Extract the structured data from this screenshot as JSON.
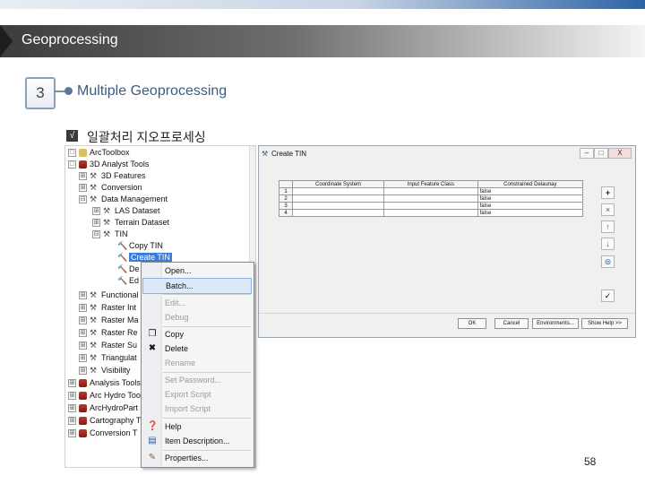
{
  "banner": {
    "title": "Geoprocessing"
  },
  "section": {
    "number": "3",
    "heading": "Multiple Geoprocessing"
  },
  "subheading": {
    "check": "√",
    "text": "일괄처리 지오프로세싱"
  },
  "tree": [
    {
      "label": "ArcToolbox",
      "exp": "□"
    },
    {
      "label": "3D Analyst Tools",
      "exp": "□"
    },
    {
      "label": "3D Features",
      "exp": "⊞"
    },
    {
      "label": "Conversion",
      "exp": "⊞"
    },
    {
      "label": "Data Management",
      "exp": "⊟"
    },
    {
      "label": "LAS Dataset",
      "exp": "⊞"
    },
    {
      "label": "Terrain Dataset",
      "exp": "⊞"
    },
    {
      "label": "TIN",
      "exp": "⊟"
    },
    {
      "label": "Copy TIN"
    },
    {
      "label": "Create TIN"
    },
    {
      "label": "De"
    },
    {
      "label": "Ed"
    },
    {
      "label": "Functional",
      "exp": "⊞"
    },
    {
      "label": "Raster Int",
      "exp": "⊞"
    },
    {
      "label": "Raster Ma",
      "exp": "⊞"
    },
    {
      "label": "Raster Re",
      "exp": "⊞"
    },
    {
      "label": "Raster Su",
      "exp": "⊞"
    },
    {
      "label": "Triangulat",
      "exp": "⊞"
    },
    {
      "label": "Visibility",
      "exp": "⊞"
    },
    {
      "label": "Analysis Tools",
      "exp": "⊞"
    },
    {
      "label": "Arc Hydro Tools",
      "exp": "⊞"
    },
    {
      "label": "ArcHydroPart",
      "exp": "⊞"
    },
    {
      "label": "Cartography T",
      "exp": "⊞"
    },
    {
      "label": "Conversion T",
      "exp": "⊞"
    }
  ],
  "context_menu": [
    {
      "label": "Open...",
      "icon": ""
    },
    {
      "label": "Batch...",
      "icon": "",
      "highlighted": true
    },
    {
      "label": "Edit...",
      "icon": "",
      "disabled": true
    },
    {
      "label": "Debug",
      "icon": "",
      "disabled": true
    },
    {
      "label": "Copy",
      "icon": "copy-icon"
    },
    {
      "label": "Delete",
      "icon": "delete-icon"
    },
    {
      "label": "Rename",
      "icon": "",
      "disabled": true
    },
    {
      "label": "Set Password...",
      "icon": "",
      "disabled": true
    },
    {
      "label": "Export Script",
      "icon": "",
      "disabled": true
    },
    {
      "label": "Import Script",
      "icon": "",
      "disabled": true
    },
    {
      "label": "Help",
      "icon": "help-icon"
    },
    {
      "label": "Item Description...",
      "icon": "document-icon"
    },
    {
      "label": "Properties...",
      "icon": "properties-icon"
    }
  ],
  "dialog": {
    "title": "Create TIN",
    "columns": [
      "Coordinate System",
      "Input Feature Class",
      "Constrained Delaunay"
    ],
    "rows": [
      {
        "num": "1",
        "cs": "",
        "ifc": "",
        "cd": "false"
      },
      {
        "num": "2",
        "cs": "",
        "ifc": "",
        "cd": "false"
      },
      {
        "num": "3",
        "cs": "",
        "ifc": "",
        "cd": "false"
      },
      {
        "num": "4",
        "cs": "",
        "ifc": "",
        "cd": "false"
      }
    ],
    "buttons": {
      "ok": "OK",
      "cancel": "Cancel",
      "environments": "Environments...",
      "show_help": "Show Help >>"
    },
    "window_buttons": {
      "minimize": "–",
      "maximize": "□",
      "close": "X"
    },
    "side_buttons": [
      "+",
      "×",
      "↑",
      "↓",
      "⊜",
      "✓"
    ]
  },
  "page_number": "58"
}
